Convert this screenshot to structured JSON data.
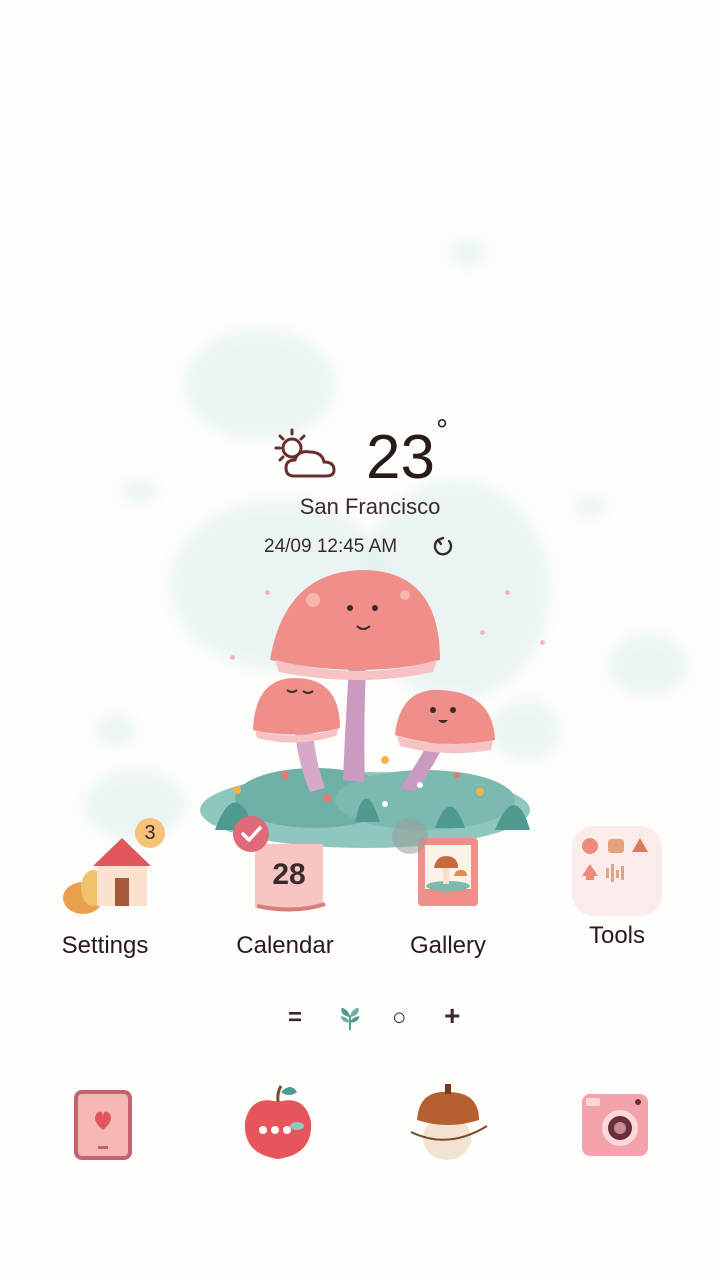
{
  "weather": {
    "temperature": "23",
    "degree_symbol": "°",
    "city": "San Francisco",
    "updated": "24/09 12:45 AM",
    "condition_icon": "partly-cloudy-icon",
    "refresh_icon": "refresh-icon"
  },
  "apps": [
    {
      "label": "Settings",
      "icon": "house-icon",
      "badge": "3"
    },
    {
      "label": "Calendar",
      "icon": "calendar-icon",
      "date": "28"
    },
    {
      "label": "Gallery",
      "icon": "photo-icon"
    },
    {
      "label": "Tools",
      "icon": "tools-folder-icon"
    }
  ],
  "pager": {
    "menu_symbol": "=",
    "page_symbol": "○",
    "add_symbol": "+"
  },
  "dock": [
    {
      "icon": "phone-tablet-icon"
    },
    {
      "icon": "apple-messages-icon"
    },
    {
      "icon": "acorn-browser-icon"
    },
    {
      "icon": "camera-icon"
    }
  ],
  "colors": {
    "accent_pink": "#f08f8a",
    "check_badge": "#e06a79",
    "badge_orange": "#f6c27a",
    "wash_teal": "#dcefed"
  }
}
